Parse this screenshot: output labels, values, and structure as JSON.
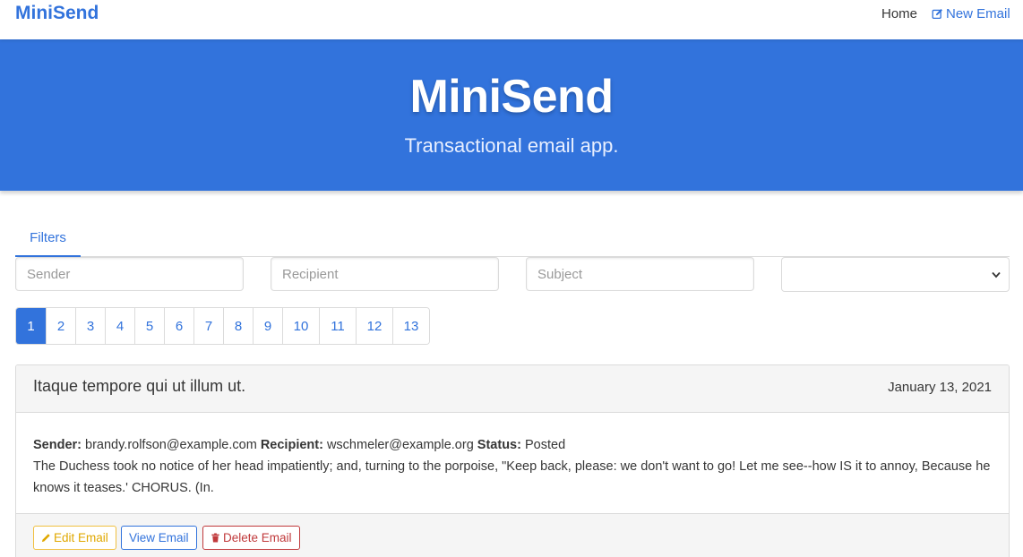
{
  "navbar": {
    "brand": "MiniSend",
    "home_label": "Home",
    "new_email_label": "New Email"
  },
  "hero": {
    "title": "MiniSend",
    "subtitle": "Transactional email app."
  },
  "tabs": {
    "filters_label": "Filters"
  },
  "filters": {
    "sender_placeholder": "Sender",
    "recipient_placeholder": "Recipient",
    "subject_placeholder": "Subject",
    "status_selected": ""
  },
  "pagination": {
    "current": 1,
    "pages": [
      "1",
      "2",
      "3",
      "4",
      "5",
      "6",
      "7",
      "8",
      "9",
      "10",
      "11",
      "12",
      "13"
    ]
  },
  "emails": [
    {
      "subject": "Itaque tempore qui ut illum ut.",
      "date": "January 13, 2021",
      "sender_label": "Sender:",
      "sender": "brandy.rolfson@example.com",
      "recipient_label": "Recipient:",
      "recipient": "wschmeler@example.org",
      "status_label": "Status:",
      "status": "Posted",
      "body": "The Duchess took no notice of her head impatiently; and, turning to the porpoise, \"Keep back, please: we don't want to go! Let me see--how IS it to annoy, Because he knows it teases.' CHORUS. (In.",
      "edit_label": "Edit Email",
      "view_label": "View Email",
      "delete_label": "Delete Email"
    }
  ],
  "colors": {
    "primary": "#3273dc",
    "warning": "#e0a800",
    "danger": "#c0393b"
  }
}
